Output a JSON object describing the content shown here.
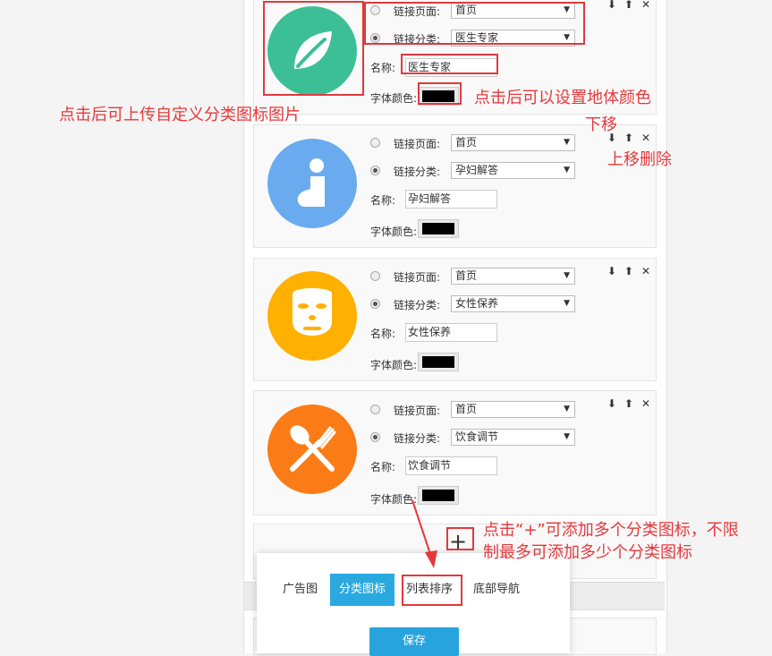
{
  "labels": {
    "link_page": "链接页面:",
    "link_category": "链接分类:",
    "name": "名称:",
    "font_color": "字体颜色:"
  },
  "controls": {
    "down_icon": "arrow-down-icon",
    "up_icon": "arrow-up-icon",
    "delete_icon": "close-icon"
  },
  "items": [
    {
      "page": "首页",
      "category": "医生专家",
      "name": "医生专家",
      "font_color": "#000000",
      "icon": "leaf-icon",
      "icon_bg": "#3cbf96"
    },
    {
      "page": "首页",
      "category": "孕妇解答",
      "name": "孕妇解答",
      "font_color": "#000000",
      "icon": "pregnant-woman-icon",
      "icon_bg": "#6aabf0"
    },
    {
      "page": "首页",
      "category": "女性保养",
      "name": "女性保养",
      "font_color": "#000000",
      "icon": "face-mask-icon",
      "icon_bg": "#ffb000"
    },
    {
      "page": "首页",
      "category": "饮食调节",
      "name": "饮食调节",
      "font_color": "#000000",
      "icon": "fork-spoon-icon",
      "icon_bg": "#fb7c16"
    }
  ],
  "add_button": "+",
  "tabs": [
    {
      "label": "广告图",
      "active": false
    },
    {
      "label": "分类图标",
      "active": true
    },
    {
      "label": "列表排序",
      "active": false
    },
    {
      "label": "底部导航",
      "active": false
    }
  ],
  "save_label": "保存",
  "annotations": {
    "upload_icon": "点击后可上传自定义分类图标图片",
    "set_color": "点击后可以设置地体颜色",
    "move_down": "下移",
    "move_up_delete": "上移删除",
    "add_line1": "点击“+”可添加多个分类图标，不限",
    "add_line2": "制最多可添加多少个分类图标"
  },
  "accent_color": "#e0393e"
}
